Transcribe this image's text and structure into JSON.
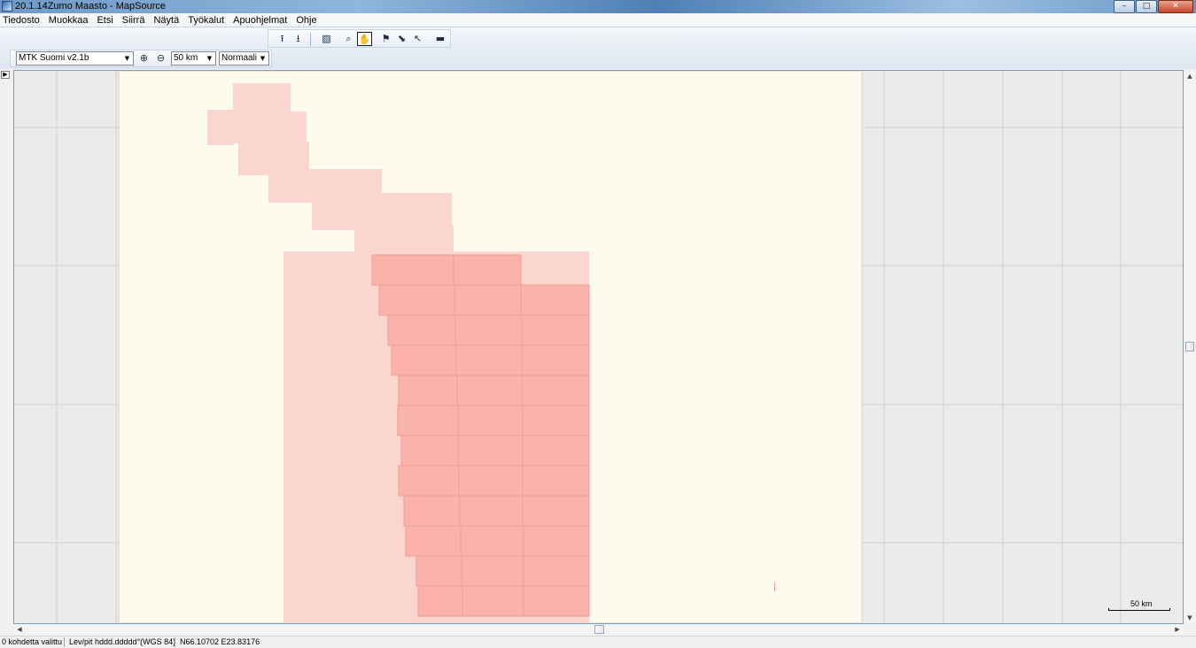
{
  "window": {
    "title": "20.1.14Zumo Maasto - MapSource",
    "buttons": [
      "–",
      "□",
      "✕"
    ]
  },
  "menu": [
    "Tiedosto",
    "Muokkaa",
    "Etsi",
    "Siirrä",
    "Näytä",
    "Työkalut",
    "Apuohjelmat",
    "Ohje"
  ],
  "toolbar": {
    "icons": [
      "receive-from-device-icon",
      "send-to-device-icon",
      "map-tool-icon",
      "zoom-tool-icon",
      "hand-tool-icon",
      "waypoint-tool-icon",
      "route-tool-icon",
      "selection-tool-icon",
      "distance-tool-icon"
    ],
    "glyphs": [
      "⭱",
      "⭳",
      "▧",
      "⌕",
      "✋",
      "⚑",
      "⬊",
      "↖",
      "▬"
    ],
    "active_tool": "hand-tool-icon"
  },
  "map_toolbar": {
    "product": "MTK Suomi v2.1b",
    "zoom_in": "⊕",
    "zoom_out": "⊖",
    "zoom_level": "50 km",
    "detail": "Normaali"
  },
  "map": {
    "background_color": "#ebebeb",
    "coverage_color": "#fdfaee",
    "tile_color_light": "#fbd6cf",
    "tile_color_selected": "#f9b3ab",
    "tile_border_color": "#f29c96"
  },
  "scale": {
    "label": "50 km"
  },
  "status": {
    "selection": "0 kohdetta valittu",
    "format": "Lev/pit hddd.ddddd°(WGS 84)",
    "coordinates": "N66.10702 E23.83176"
  }
}
